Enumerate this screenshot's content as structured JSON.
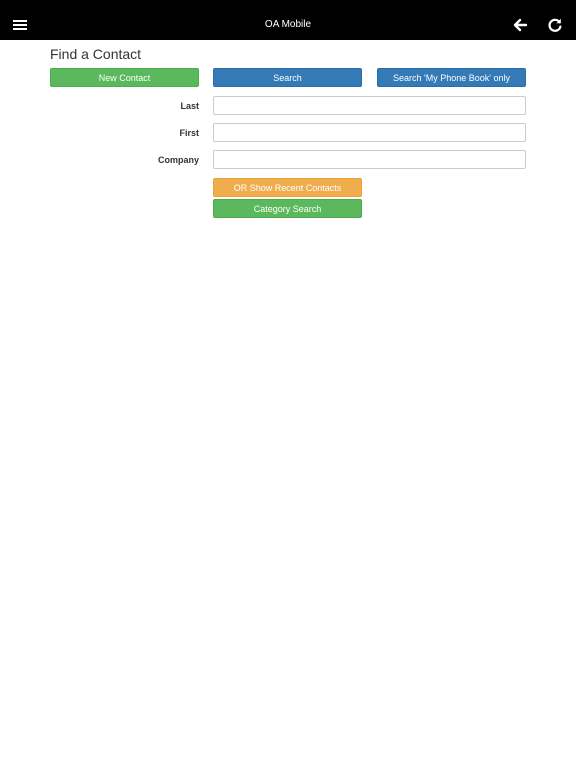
{
  "app": {
    "title": "OA Mobile",
    "icons": {
      "menu": "hamburger-menu-icon",
      "back": "arrow-left-icon",
      "refresh": "refresh-icon"
    },
    "colors": {
      "navbar": "#000000",
      "green": "#5cb85c",
      "blue": "#337ab7",
      "orange": "#f0ad4e"
    }
  },
  "page": {
    "title": "Find a Contact"
  },
  "actions": {
    "new_contact": "New Contact",
    "search": "Search",
    "search_phone_book": "Search 'My Phone Book' only",
    "recent_contacts": "OR Show Recent Contacts",
    "category_search": "Category Search"
  },
  "form": {
    "last": {
      "label": "Last",
      "value": "",
      "placeholder": ""
    },
    "first": {
      "label": "First",
      "value": "",
      "placeholder": ""
    },
    "company": {
      "label": "Company",
      "value": "",
      "placeholder": ""
    }
  }
}
